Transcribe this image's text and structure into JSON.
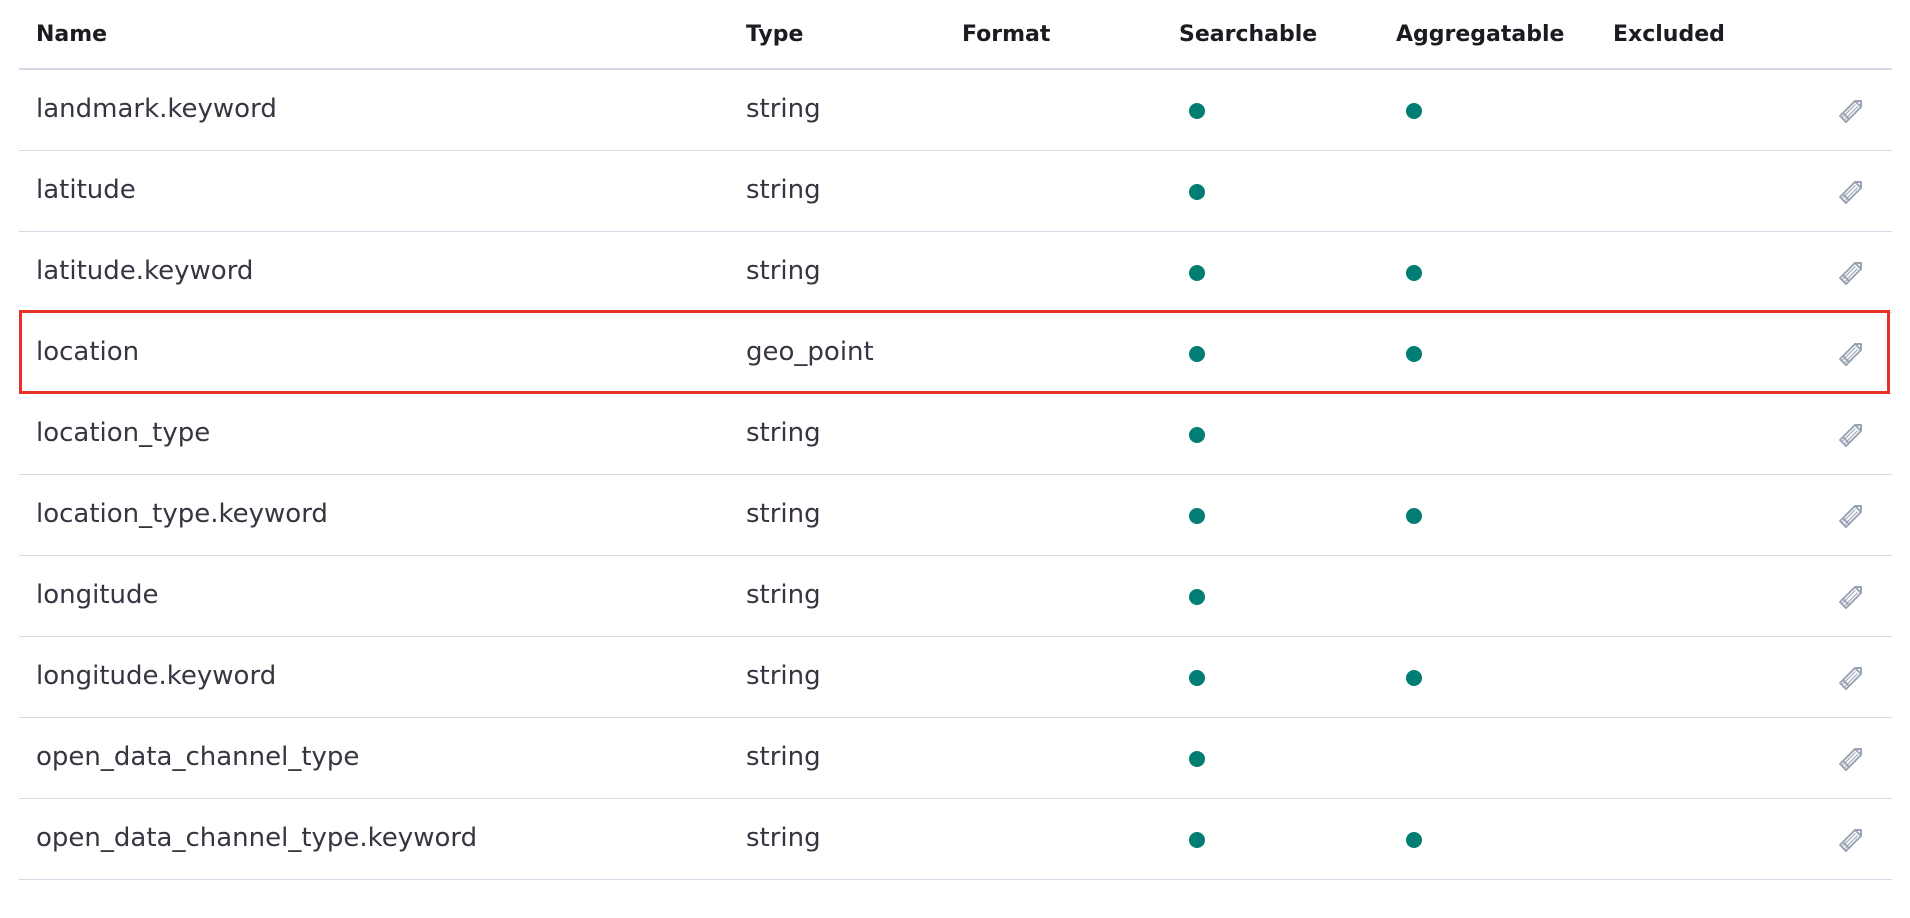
{
  "columns": {
    "name": "Name",
    "type": "Type",
    "format": "Format",
    "searchable": "Searchable",
    "aggregatable": "Aggregatable",
    "excluded": "Excluded"
  },
  "rows": [
    {
      "name": "landmark.keyword",
      "type": "string",
      "format": "",
      "searchable": true,
      "aggregatable": true,
      "excluded": false,
      "highlighted": false
    },
    {
      "name": "latitude",
      "type": "string",
      "format": "",
      "searchable": true,
      "aggregatable": false,
      "excluded": false,
      "highlighted": false
    },
    {
      "name": "latitude.keyword",
      "type": "string",
      "format": "",
      "searchable": true,
      "aggregatable": true,
      "excluded": false,
      "highlighted": false
    },
    {
      "name": "location",
      "type": "geo_point",
      "format": "",
      "searchable": true,
      "aggregatable": true,
      "excluded": false,
      "highlighted": true
    },
    {
      "name": "location_type",
      "type": "string",
      "format": "",
      "searchable": true,
      "aggregatable": false,
      "excluded": false,
      "highlighted": false
    },
    {
      "name": "location_type.keyword",
      "type": "string",
      "format": "",
      "searchable": true,
      "aggregatable": true,
      "excluded": false,
      "highlighted": false
    },
    {
      "name": "longitude",
      "type": "string",
      "format": "",
      "searchable": true,
      "aggregatable": false,
      "excluded": false,
      "highlighted": false
    },
    {
      "name": "longitude.keyword",
      "type": "string",
      "format": "",
      "searchable": true,
      "aggregatable": true,
      "excluded": false,
      "highlighted": false
    },
    {
      "name": "open_data_channel_type",
      "type": "string",
      "format": "",
      "searchable": true,
      "aggregatable": false,
      "excluded": false,
      "highlighted": false
    },
    {
      "name": "open_data_channel_type.keyword",
      "type": "string",
      "format": "",
      "searchable": true,
      "aggregatable": true,
      "excluded": false,
      "highlighted": false
    }
  ],
  "icons": {
    "edit": "pencil-icon",
    "status": "dot-indicator"
  },
  "colors": {
    "dot": "#017d73",
    "highlight_border": "#e7302a",
    "divider": "#d3dae6",
    "text": "#343741",
    "edit_icon": "#98a2b3"
  }
}
